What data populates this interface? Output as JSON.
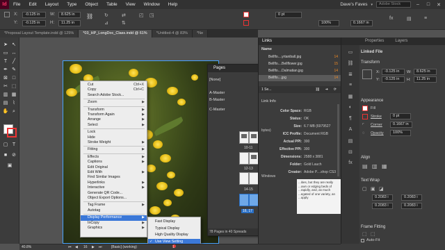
{
  "menubar": {
    "logo": "Id",
    "items": [
      "File",
      "Edit",
      "Layout",
      "Type",
      "Object",
      "Table",
      "View",
      "Window",
      "Help"
    ],
    "workspace": "Dave's Faves",
    "search_placeholder": "Adobe Stock"
  },
  "control": {
    "x": "-0.125 in",
    "y": "-0.125 in",
    "w": "8.625 in",
    "h": "11.25 in",
    "stroke": "0 pt",
    "offset": "0.1667 in",
    "zoom": "100%"
  },
  "tabs": [
    {
      "label": "*Proposal Layout Template.indd @ 125%",
      "active": false
    },
    {
      "label": "*03_HP_LongDoc_Class.indd @ 61%",
      "active": true
    },
    {
      "label": "*Untitled-4 @ 83%",
      "active": false
    },
    {
      "label": "*Ne",
      "active": false
    }
  ],
  "context_menu": {
    "items": [
      {
        "label": "Cut",
        "shortcut": "Ctrl+X"
      },
      {
        "label": "Copy",
        "shortcut": "Ctrl+C"
      },
      {
        "label": "Search Adobe Stock..."
      },
      {
        "sep": true
      },
      {
        "label": "Zoom",
        "submenu": true
      },
      {
        "sep": true
      },
      {
        "label": "Transform",
        "submenu": true
      },
      {
        "label": "Transform Again",
        "submenu": true
      },
      {
        "label": "Arrange",
        "submenu": true
      },
      {
        "label": "Select",
        "submenu": true
      },
      {
        "sep": true
      },
      {
        "label": "Lock"
      },
      {
        "label": "Hide"
      },
      {
        "label": "Stroke Weight",
        "submenu": true
      },
      {
        "sep": true
      },
      {
        "label": "Fitting",
        "submenu": true
      },
      {
        "sep": true
      },
      {
        "label": "Effects",
        "submenu": true
      },
      {
        "label": "Captions",
        "submenu": true
      },
      {
        "label": "Edit Original"
      },
      {
        "label": "Edit With",
        "submenu": true
      },
      {
        "label": "Find Similar Images"
      },
      {
        "label": "Hyperlinks",
        "submenu": true
      },
      {
        "label": "Interactive",
        "submenu": true
      },
      {
        "label": "Generate QR Code..."
      },
      {
        "label": "Object Export Options..."
      },
      {
        "sep": true
      },
      {
        "label": "Tag Frame",
        "submenu": true
      },
      {
        "label": "Autotag"
      },
      {
        "sep": true
      },
      {
        "label": "Display Performance",
        "submenu": true,
        "highlight": true
      },
      {
        "label": "InCopy",
        "submenu": true
      },
      {
        "label": "Graphics",
        "submenu": true
      }
    ]
  },
  "submenu": {
    "items": [
      {
        "label": "Fast Display",
        "checked": false
      },
      {
        "label": "Typical Display",
        "checked": false
      },
      {
        "label": "High Quality Display",
        "checked": false
      },
      {
        "label": "Use View Setting",
        "checked": true,
        "highlight": true
      }
    ]
  },
  "pages_panel": {
    "title": "Pages",
    "masters": [
      "[None]",
      "A-Master",
      "B-Master",
      "C-Master"
    ],
    "page_labels": [
      "10-11",
      "12-13",
      "14-15",
      "16, 17"
    ],
    "footer": "78 Pages in 40 Spreads"
  },
  "links_panel": {
    "title": "Links",
    "column": "Name",
    "rows": [
      {
        "name": "Bellflo....yrtaniball.jpg",
        "page": "14"
      },
      {
        "name": "Bellflo....Bellflower.jpg",
        "page": "15"
      },
      {
        "name": "Bellflo....Dalmatian.jpg",
        "page": "14"
      },
      {
        "name": "Bellflo....jpg",
        "page": "14"
      }
    ],
    "selected_count": "1 Se...",
    "info_title": "Link Info",
    "info": [
      {
        "key": "Color Space:",
        "value": "RGB"
      },
      {
        "key": "Status:",
        "value": "OK"
      },
      {
        "key": "Size:",
        "value": "6.7 MB (6979527 bytes)"
      },
      {
        "key": "ICC Profile:",
        "value": "Document RGB"
      },
      {
        "key": "Actual PPI:",
        "value": "300"
      },
      {
        "key": "Effective PPI:",
        "value": "300"
      },
      {
        "key": "Dimensions:",
        "value": "2588 x 3881"
      },
      {
        "key": "Folder:",
        "value": "Gold Lauch"
      },
      {
        "key": "Creator:",
        "value": "Adobe P....shop CS3 Windows"
      }
    ]
  },
  "text_frame": "...ities, but they are really ...own or edging beds of ...rapidly, and, as much ...egated of one variety, an ...upply",
  "properties": {
    "tabs": [
      "Properties",
      "Layers"
    ],
    "linked_file": "Linked File",
    "transform_title": "Transform",
    "x": "-0.125 in",
    "y": "-0.125 in",
    "w": "8.625 in",
    "h": "11.25 in",
    "appearance_title": "Appearance",
    "fill_label": "Fill",
    "stroke_label": "Stroke",
    "stroke_value": "0 pt",
    "corner_label": "Corner",
    "corner_value": "0.1667 in",
    "opacity_label": "Opacity",
    "opacity_value": "100%",
    "align_title": "Align",
    "text_wrap_title": "Text Wrap",
    "wrap_values": [
      "0.2083 i",
      "0.2083 i",
      "0.2083 i",
      "0.2083 i"
    ],
    "frame_fitting_title": "Frame Fitting",
    "auto_fit": "Auto-Fit"
  },
  "status": {
    "zoom": "40.8%",
    "page": "16",
    "style": "[Basic] (working)",
    "errors": "1 error"
  }
}
